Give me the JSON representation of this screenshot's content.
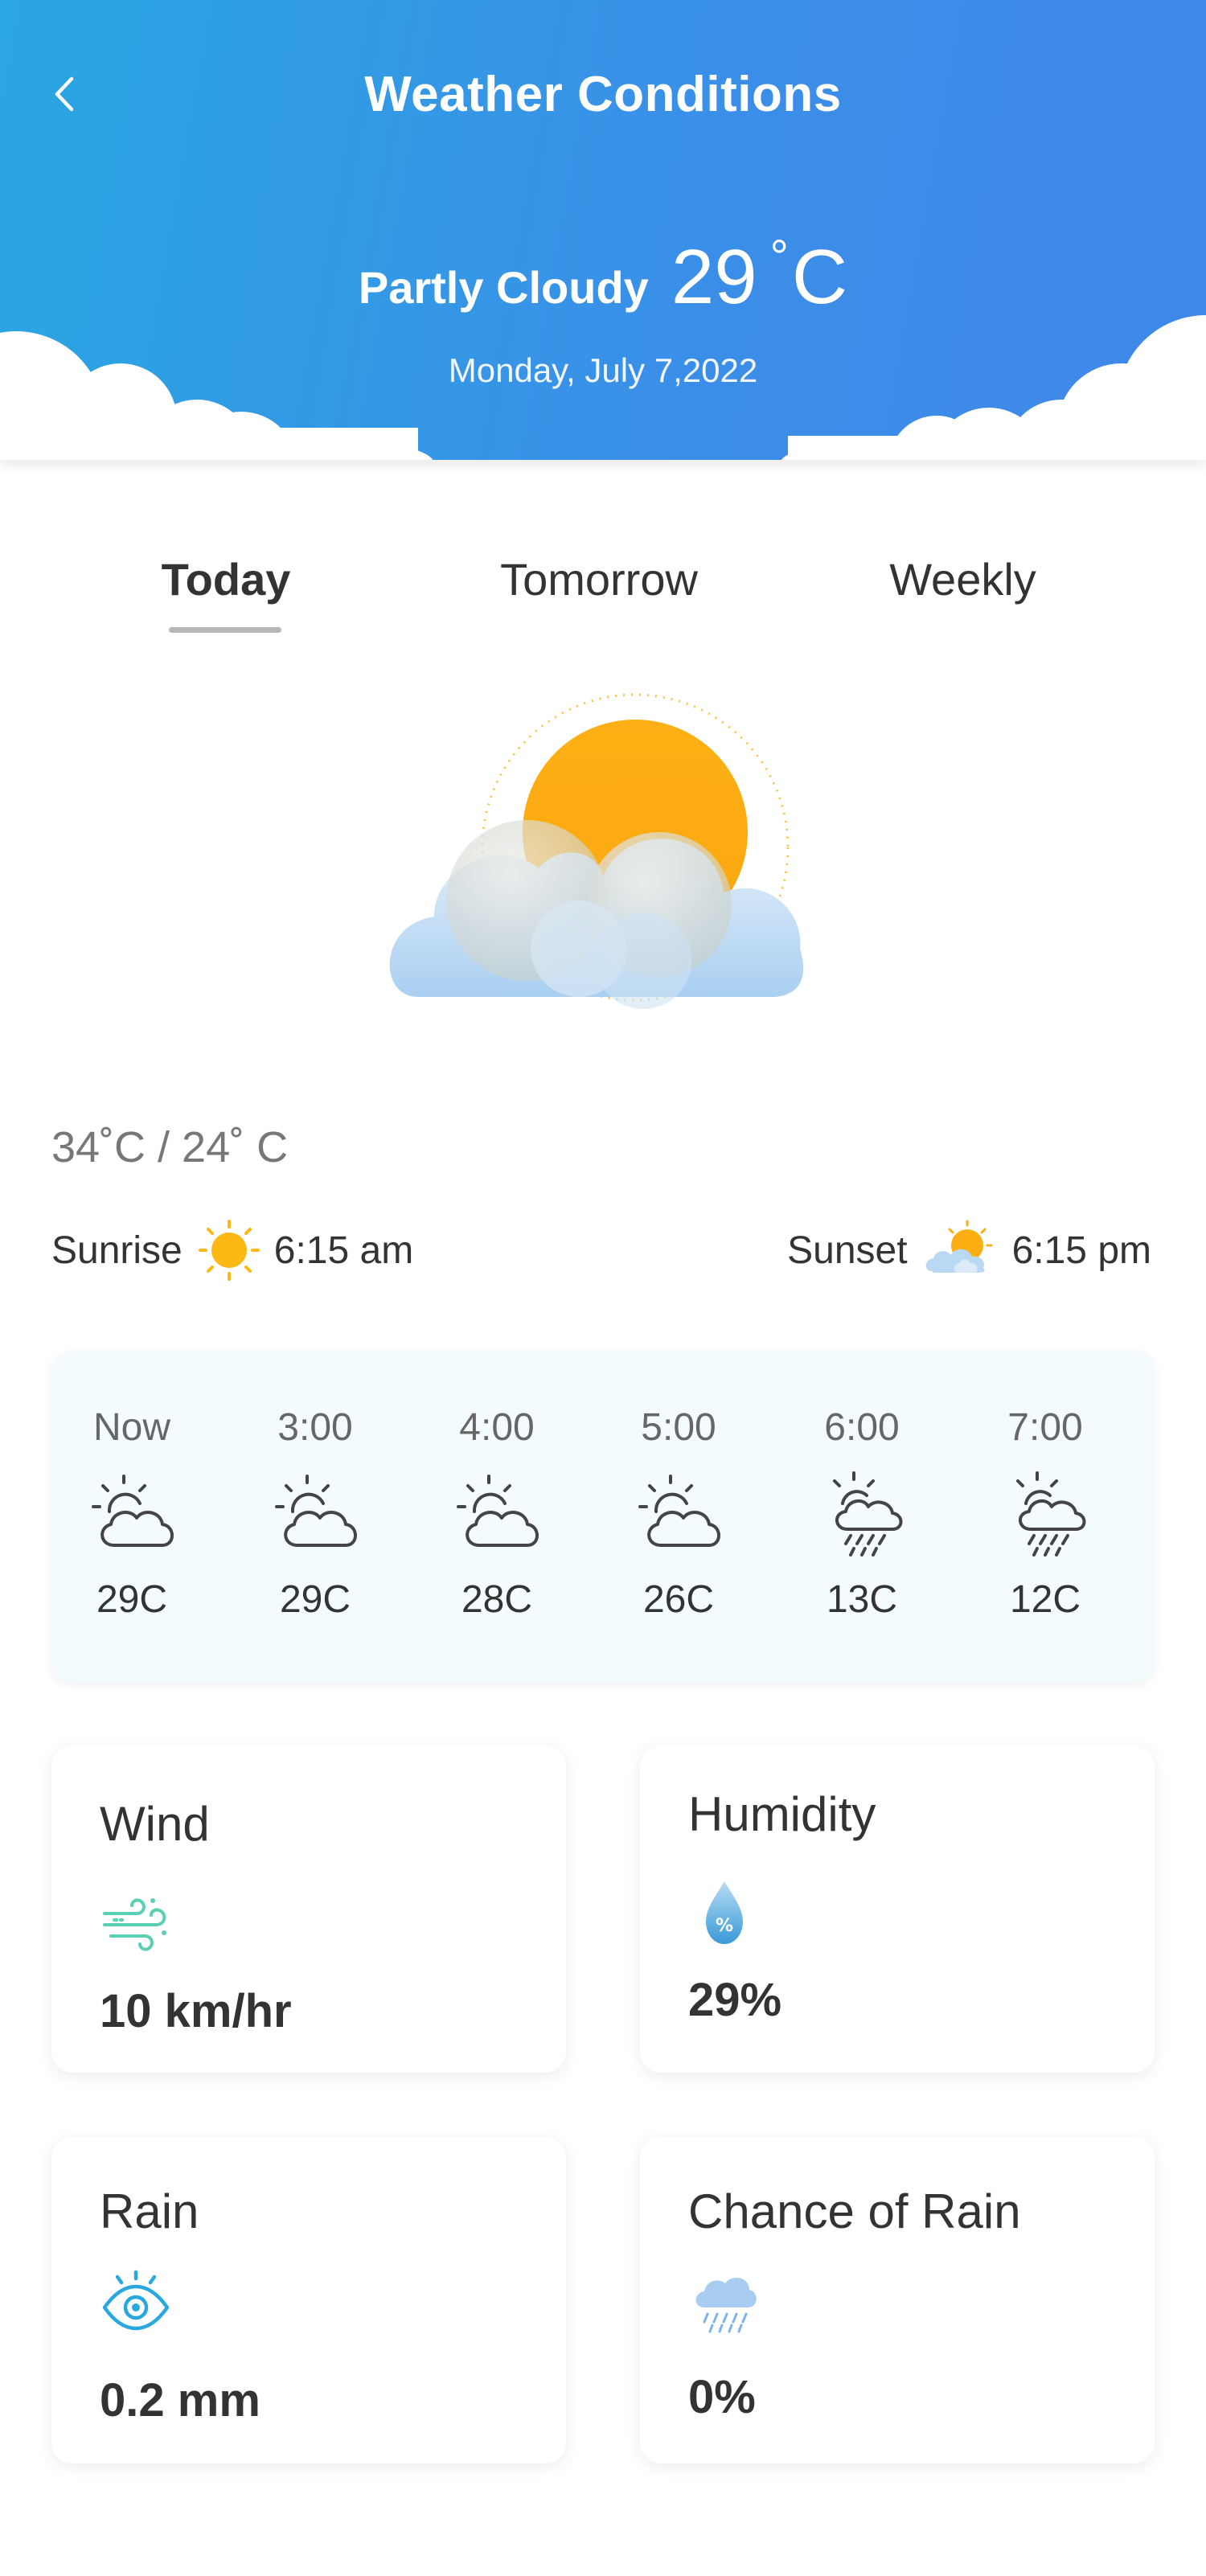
{
  "header": {
    "title": "Weather Conditions",
    "condition": "Partly Cloudy",
    "temperature": "29",
    "degree_symbol": "°",
    "unit": "C",
    "date": "Monday, July 7,2022"
  },
  "tabs": [
    {
      "label": "Today",
      "active": true
    },
    {
      "label": "Tomorrow",
      "active": false
    },
    {
      "label": "Weekly",
      "active": false
    }
  ],
  "summary": {
    "hi_lo": "34˚C / 24˚ C",
    "sunrise_label": "Sunrise",
    "sunrise_time": "6:15 am",
    "sunset_label": "Sunset",
    "sunset_time": "6:15 pm"
  },
  "hourly": [
    {
      "time": "Now",
      "temp": "29C",
      "icon": "partly-cloudy-icon"
    },
    {
      "time": "3:00",
      "temp": "29C",
      "icon": "partly-cloudy-icon"
    },
    {
      "time": "4:00",
      "temp": "28C",
      "icon": "partly-cloudy-icon"
    },
    {
      "time": "5:00",
      "temp": "26C",
      "icon": "partly-cloudy-icon"
    },
    {
      "time": "6:00",
      "temp": "13C",
      "icon": "sun-rain-icon"
    },
    {
      "time": "7:00",
      "temp": "12C",
      "icon": "sun-rain-icon"
    }
  ],
  "stats": {
    "wind": {
      "title": "Wind",
      "value": "10 km/hr",
      "icon": "wind-icon"
    },
    "humidity": {
      "title": "Humidity",
      "value": "29%",
      "icon": "humidity-drop-icon"
    },
    "rain": {
      "title": "Rain",
      "value": "0.2 mm",
      "icon": "eye-icon"
    },
    "chance_of_rain": {
      "title": "Chance of Rain",
      "value": "0%",
      "icon": "rain-cloud-icon"
    }
  },
  "colors": {
    "header_gradient_start": "#2aa6e2",
    "header_gradient_end": "#3f87ea",
    "sun": "#fdae12",
    "wind_icon": "#5bcfb5",
    "eye_icon": "#29a7df",
    "hourly_card_bg": "#f4fbff"
  }
}
